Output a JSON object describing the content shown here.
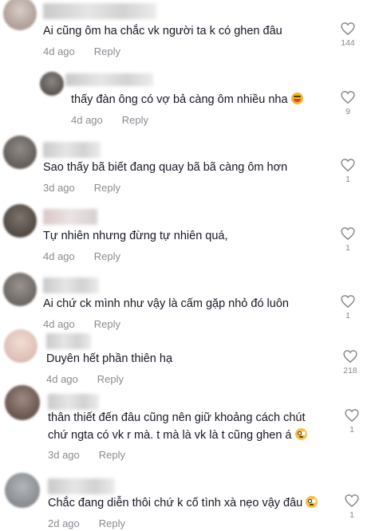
{
  "comments": [
    {
      "text": "Ai cũng ôm ha chắc vk người ta k có ghen đâu",
      "time": "4d ago",
      "reply": "Reply",
      "likes": "144",
      "emoji": null,
      "avatar_color": "#b8a9a2"
    },
    {
      "text": "thấy đàn ông có vợ bả càng ôm nhiều nha",
      "time": "4d ago",
      "reply": "Reply",
      "likes": "9",
      "emoji": "laugh-emoji",
      "avatar_color": "#6b6660"
    },
    {
      "text": "Sao thấy bã biết đang quay bã bã càng ôm hơn",
      "time": "3d ago",
      "reply": "Reply",
      "likes": "1",
      "emoji": null,
      "avatar_color": "#726d6a"
    },
    {
      "text": "Tự nhiên nhưng đừng tự nhiên quá,",
      "time": "4d ago",
      "reply": "Reply",
      "likes": "1",
      "emoji": null,
      "avatar_color": "#5e5650"
    },
    {
      "text": "Ai chứ ck mình như vậy là cấm gặp nhỏ đó luôn",
      "time": "4d ago",
      "reply": "Reply",
      "likes": "1",
      "emoji": null,
      "avatar_color": "#7c7672"
    },
    {
      "text": "Duyên hết phần thiên hạ",
      "time": "4d ago",
      "reply": "Reply",
      "likes": "218",
      "emoji": null,
      "avatar_color": "#e3c9c0"
    },
    {
      "text": "thân thiết đến đâu cũng nên giữ khoảng cách chút",
      "text2": "chứ ngta có vk r mà. t mà là vk là t cũng ghen á",
      "time": "3d ago",
      "reply": "Reply",
      "likes": "1",
      "emoji": "flushed-emoji",
      "avatar_color": "#6a5650"
    },
    {
      "text": "Chắc đang diễn thôi chứ k cố tình xà nẹo vậy đâu",
      "time": "2d ago",
      "reply": "Reply",
      "likes": "1",
      "emoji": "flushed-emoji",
      "avatar_color": "#8c8f93"
    }
  ],
  "colors": {
    "text": "#161823",
    "meta": "#8a8b91",
    "background": "#ffffff"
  }
}
